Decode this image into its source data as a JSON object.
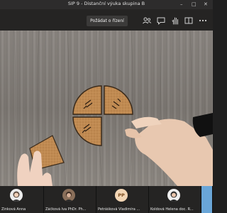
{
  "window": {
    "title": "SIP 9 - Distanční výuka skupina B",
    "minimize_glyph": "–",
    "maximize_glyph": "□",
    "close_glyph": "✕"
  },
  "toolbar": {
    "request_control_label": "Požádat o řízení",
    "icons": [
      "participants-icon",
      "chat-icon",
      "raise-hand-icon",
      "rooms-icon",
      "more-options-icon"
    ]
  },
  "participants": [
    {
      "name": "Žinková Anna",
      "avatar": "photo"
    },
    {
      "name": "Žáčková Iva PhDr. Ph...",
      "avatar": "photo"
    },
    {
      "name": "Petrášková Vladimíra ...",
      "initials": "PP",
      "avatar": "initials"
    },
    {
      "name": "Koldová Helena doc. R...",
      "avatar": "photo"
    }
  ],
  "colors": {
    "accent": "#6264a7",
    "toolbar_bg": "#252423",
    "initials_bg": "#f3d6b5"
  }
}
